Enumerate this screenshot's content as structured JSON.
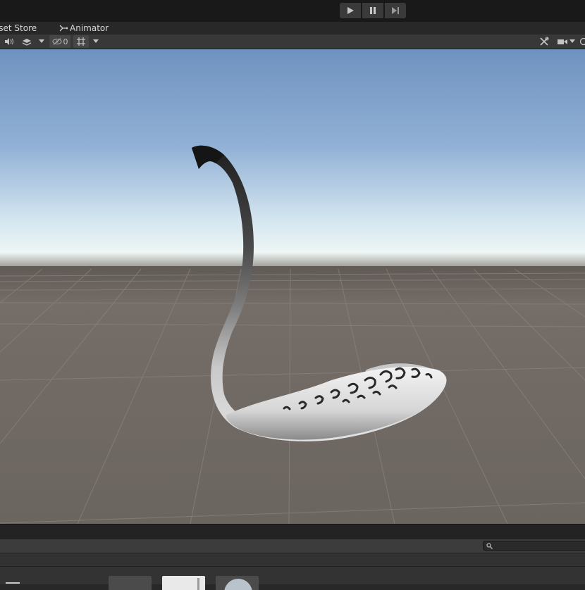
{
  "toolbar": {
    "play_icon": "play-icon",
    "pause_icon": "pause-icon",
    "step_icon": "step-icon"
  },
  "tabs": [
    {
      "label": "sset Store"
    },
    {
      "label": "Animator",
      "icon": "animator-icon"
    }
  ],
  "scene_toolbar": {
    "audio_icon": "audio-icon",
    "effects_icon": "effects-icon",
    "hidden_count": "0",
    "grid_icon": "grid-icon",
    "tools_icon": "tools-icon",
    "camera_icon": "camera-icon"
  },
  "scene": {
    "sky_top": "#6f93c0",
    "sky_horizon": "#e6f2f3",
    "ground": "#6b6560",
    "object": "swan-shaped mesh with leopard texture"
  },
  "project": {
    "search_placeholder": ""
  }
}
